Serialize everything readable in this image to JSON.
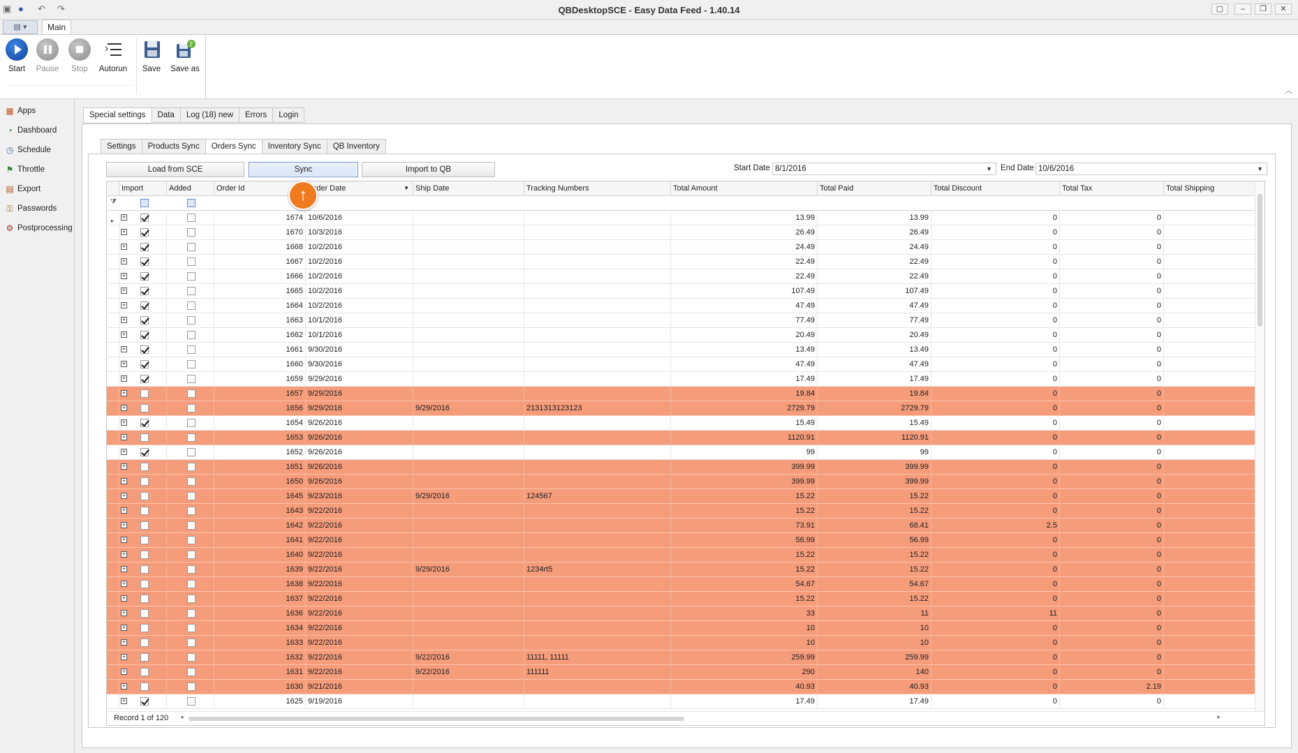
{
  "window": {
    "title": "QBDesktopSCE - Easy Data Feed - 1.40.14"
  },
  "ribbon": {
    "tab": "Main",
    "buttons": [
      {
        "label": "Start",
        "icon": "play-icon",
        "enabled": true
      },
      {
        "label": "Pause",
        "icon": "pause-icon",
        "enabled": false
      },
      {
        "label": "Stop",
        "icon": "stop-icon",
        "enabled": false
      },
      {
        "label": "Autorun",
        "icon": "list-icon",
        "enabled": true
      },
      {
        "label": "Save",
        "icon": "floppy-disk-icon",
        "enabled": true
      },
      {
        "label": "Save as",
        "icon": "floppy-disk-plus-icon",
        "enabled": true
      }
    ]
  },
  "sidebar": {
    "items": [
      {
        "label": "Apps",
        "icon": "apps-icon"
      },
      {
        "label": "Dashboard",
        "icon": "dashboard-icon"
      },
      {
        "label": "Schedule",
        "icon": "schedule-icon"
      },
      {
        "label": "Throttle",
        "icon": "flag-icon"
      },
      {
        "label": "Export",
        "icon": "export-grid-icon"
      },
      {
        "label": "Passwords",
        "icon": "key-icon"
      },
      {
        "label": "Postprocessing",
        "icon": "postprocessing-icon"
      }
    ]
  },
  "outer_tabs": [
    "Special settings",
    "Data",
    "Log (18) new",
    "Errors",
    "Login"
  ],
  "outer_active": "Special settings",
  "inner_tabs": [
    "Settings",
    "Products Sync",
    "Orders Sync",
    "Inventory Sync",
    "QB Inventory"
  ],
  "inner_active": "Orders Sync",
  "toolbar": {
    "load_label": "Load from SCE",
    "sync_label": "Sync",
    "import_label": "Import to QB",
    "start_date_label": "Start Date",
    "start_date": "8/1/2016",
    "end_date_label": "End Date",
    "end_date": "10/6/2016"
  },
  "grid": {
    "columns": [
      "Import",
      "Added",
      "Order Id",
      "Order Date",
      "Ship Date",
      "Tracking Numbers",
      "Total Amount",
      "Total Paid",
      "Total Discount",
      "Total Tax",
      "Total Shipping"
    ],
    "highlight_color": "#f59c7b",
    "rows": [
      {
        "id": "1674",
        "date": "10/6/2016",
        "ship": "",
        "tracking": "",
        "amount": "13.99",
        "paid": "13.99",
        "discount": "0",
        "tax": "0",
        "shipping": "",
        "import": true,
        "added": false,
        "highlight": false
      },
      {
        "id": "1670",
        "date": "10/3/2016",
        "ship": "",
        "tracking": "",
        "amount": "26.49",
        "paid": "26.49",
        "discount": "0",
        "tax": "0",
        "shipping": "",
        "import": true,
        "added": false,
        "highlight": false
      },
      {
        "id": "1668",
        "date": "10/2/2016",
        "ship": "",
        "tracking": "",
        "amount": "24.49",
        "paid": "24.49",
        "discount": "0",
        "tax": "0",
        "shipping": "",
        "import": true,
        "added": false,
        "highlight": false
      },
      {
        "id": "1667",
        "date": "10/2/2016",
        "ship": "",
        "tracking": "",
        "amount": "22.49",
        "paid": "22.49",
        "discount": "0",
        "tax": "0",
        "shipping": "",
        "import": true,
        "added": false,
        "highlight": false
      },
      {
        "id": "1666",
        "date": "10/2/2016",
        "ship": "",
        "tracking": "",
        "amount": "22.49",
        "paid": "22.49",
        "discount": "0",
        "tax": "0",
        "shipping": "",
        "import": true,
        "added": false,
        "highlight": false
      },
      {
        "id": "1665",
        "date": "10/2/2016",
        "ship": "",
        "tracking": "",
        "amount": "107.49",
        "paid": "107.49",
        "discount": "0",
        "tax": "0",
        "shipping": "",
        "import": true,
        "added": false,
        "highlight": false
      },
      {
        "id": "1664",
        "date": "10/2/2016",
        "ship": "",
        "tracking": "",
        "amount": "47.49",
        "paid": "47.49",
        "discount": "0",
        "tax": "0",
        "shipping": "",
        "import": true,
        "added": false,
        "highlight": false
      },
      {
        "id": "1663",
        "date": "10/1/2016",
        "ship": "",
        "tracking": "",
        "amount": "77.49",
        "paid": "77.49",
        "discount": "0",
        "tax": "0",
        "shipping": "",
        "import": true,
        "added": false,
        "highlight": false
      },
      {
        "id": "1662",
        "date": "10/1/2016",
        "ship": "",
        "tracking": "",
        "amount": "20.49",
        "paid": "20.49",
        "discount": "0",
        "tax": "0",
        "shipping": "",
        "import": true,
        "added": false,
        "highlight": false
      },
      {
        "id": "1661",
        "date": "9/30/2016",
        "ship": "",
        "tracking": "",
        "amount": "13.49",
        "paid": "13.49",
        "discount": "0",
        "tax": "0",
        "shipping": "",
        "import": true,
        "added": false,
        "highlight": false
      },
      {
        "id": "1660",
        "date": "9/30/2016",
        "ship": "",
        "tracking": "",
        "amount": "47.49",
        "paid": "47.49",
        "discount": "0",
        "tax": "0",
        "shipping": "",
        "import": true,
        "added": false,
        "highlight": false
      },
      {
        "id": "1659",
        "date": "9/29/2016",
        "ship": "",
        "tracking": "",
        "amount": "17.49",
        "paid": "17.49",
        "discount": "0",
        "tax": "0",
        "shipping": "",
        "import": true,
        "added": false,
        "highlight": false
      },
      {
        "id": "1657",
        "date": "9/29/2016",
        "ship": "",
        "tracking": "",
        "amount": "19.84",
        "paid": "19.84",
        "discount": "0",
        "tax": "0",
        "shipping": "",
        "import": false,
        "added": false,
        "highlight": true
      },
      {
        "id": "1656",
        "date": "9/29/2016",
        "ship": "9/29/2016",
        "tracking": "2131313123123",
        "amount": "2729.79",
        "paid": "2729.79",
        "discount": "0",
        "tax": "0",
        "shipping": "",
        "import": false,
        "added": false,
        "highlight": true
      },
      {
        "id": "1654",
        "date": "9/26/2016",
        "ship": "",
        "tracking": "",
        "amount": "15.49",
        "paid": "15.49",
        "discount": "0",
        "tax": "0",
        "shipping": "",
        "import": true,
        "added": false,
        "highlight": false
      },
      {
        "id": "1653",
        "date": "9/26/2016",
        "ship": "",
        "tracking": "",
        "amount": "1120.91",
        "paid": "1120.91",
        "discount": "0",
        "tax": "0",
        "shipping": "",
        "import": false,
        "added": false,
        "highlight": true
      },
      {
        "id": "1652",
        "date": "9/26/2016",
        "ship": "",
        "tracking": "",
        "amount": "99",
        "paid": "99",
        "discount": "0",
        "tax": "0",
        "shipping": "",
        "import": true,
        "added": false,
        "highlight": false
      },
      {
        "id": "1651",
        "date": "9/26/2016",
        "ship": "",
        "tracking": "",
        "amount": "399.99",
        "paid": "399.99",
        "discount": "0",
        "tax": "0",
        "shipping": "",
        "import": false,
        "added": false,
        "highlight": true
      },
      {
        "id": "1650",
        "date": "9/26/2016",
        "ship": "",
        "tracking": "",
        "amount": "399.99",
        "paid": "399.99",
        "discount": "0",
        "tax": "0",
        "shipping": "",
        "import": false,
        "added": false,
        "highlight": true
      },
      {
        "id": "1645",
        "date": "9/23/2016",
        "ship": "9/29/2016",
        "tracking": "124567",
        "amount": "15.22",
        "paid": "15.22",
        "discount": "0",
        "tax": "0",
        "shipping": "",
        "import": false,
        "added": false,
        "highlight": true
      },
      {
        "id": "1643",
        "date": "9/22/2016",
        "ship": "",
        "tracking": "",
        "amount": "15.22",
        "paid": "15.22",
        "discount": "0",
        "tax": "0",
        "shipping": "",
        "import": false,
        "added": false,
        "highlight": true
      },
      {
        "id": "1642",
        "date": "9/22/2016",
        "ship": "",
        "tracking": "",
        "amount": "73.91",
        "paid": "68.41",
        "discount": "2.5",
        "tax": "0",
        "shipping": "",
        "import": false,
        "added": false,
        "highlight": true
      },
      {
        "id": "1641",
        "date": "9/22/2016",
        "ship": "",
        "tracking": "",
        "amount": "56.99",
        "paid": "56.99",
        "discount": "0",
        "tax": "0",
        "shipping": "",
        "import": false,
        "added": false,
        "highlight": true
      },
      {
        "id": "1640",
        "date": "9/22/2016",
        "ship": "",
        "tracking": "",
        "amount": "15.22",
        "paid": "15.22",
        "discount": "0",
        "tax": "0",
        "shipping": "",
        "import": false,
        "added": false,
        "highlight": true
      },
      {
        "id": "1639",
        "date": "9/22/2016",
        "ship": "9/29/2016",
        "tracking": "1234rt5",
        "amount": "15.22",
        "paid": "15.22",
        "discount": "0",
        "tax": "0",
        "shipping": "",
        "import": false,
        "added": false,
        "highlight": true
      },
      {
        "id": "1638",
        "date": "9/22/2016",
        "ship": "",
        "tracking": "",
        "amount": "54.67",
        "paid": "54.67",
        "discount": "0",
        "tax": "0",
        "shipping": "",
        "import": false,
        "added": false,
        "highlight": true
      },
      {
        "id": "1637",
        "date": "9/22/2016",
        "ship": "",
        "tracking": "",
        "amount": "15.22",
        "paid": "15.22",
        "discount": "0",
        "tax": "0",
        "shipping": "",
        "import": false,
        "added": false,
        "highlight": true
      },
      {
        "id": "1636",
        "date": "9/22/2016",
        "ship": "",
        "tracking": "",
        "amount": "33",
        "paid": "11",
        "discount": "11",
        "tax": "0",
        "shipping": "",
        "import": false,
        "added": false,
        "highlight": true
      },
      {
        "id": "1634",
        "date": "9/22/2016",
        "ship": "",
        "tracking": "",
        "amount": "10",
        "paid": "10",
        "discount": "0",
        "tax": "0",
        "shipping": "",
        "import": false,
        "added": false,
        "highlight": true
      },
      {
        "id": "1633",
        "date": "9/22/2016",
        "ship": "",
        "tracking": "",
        "amount": "10",
        "paid": "10",
        "discount": "0",
        "tax": "0",
        "shipping": "",
        "import": false,
        "added": false,
        "highlight": true
      },
      {
        "id": "1632",
        "date": "9/22/2016",
        "ship": "9/22/2016",
        "tracking": "11111, 11111",
        "amount": "259.99",
        "paid": "259.99",
        "discount": "0",
        "tax": "0",
        "shipping": "",
        "import": false,
        "added": false,
        "highlight": true
      },
      {
        "id": "1631",
        "date": "9/22/2016",
        "ship": "9/22/2016",
        "tracking": "111111",
        "amount": "290",
        "paid": "140",
        "discount": "0",
        "tax": "0",
        "shipping": "",
        "import": false,
        "added": false,
        "highlight": true
      },
      {
        "id": "1630",
        "date": "9/21/2016",
        "ship": "",
        "tracking": "",
        "amount": "40.93",
        "paid": "40.93",
        "discount": "0",
        "tax": "2.19",
        "shipping": "",
        "import": false,
        "added": false,
        "highlight": true
      },
      {
        "id": "1625",
        "date": "9/19/2016",
        "ship": "",
        "tracking": "",
        "amount": "17.49",
        "paid": "17.49",
        "discount": "0",
        "tax": "0",
        "shipping": "",
        "import": true,
        "added": false,
        "highlight": false
      }
    ],
    "record_status": "Record 1 of 120"
  }
}
